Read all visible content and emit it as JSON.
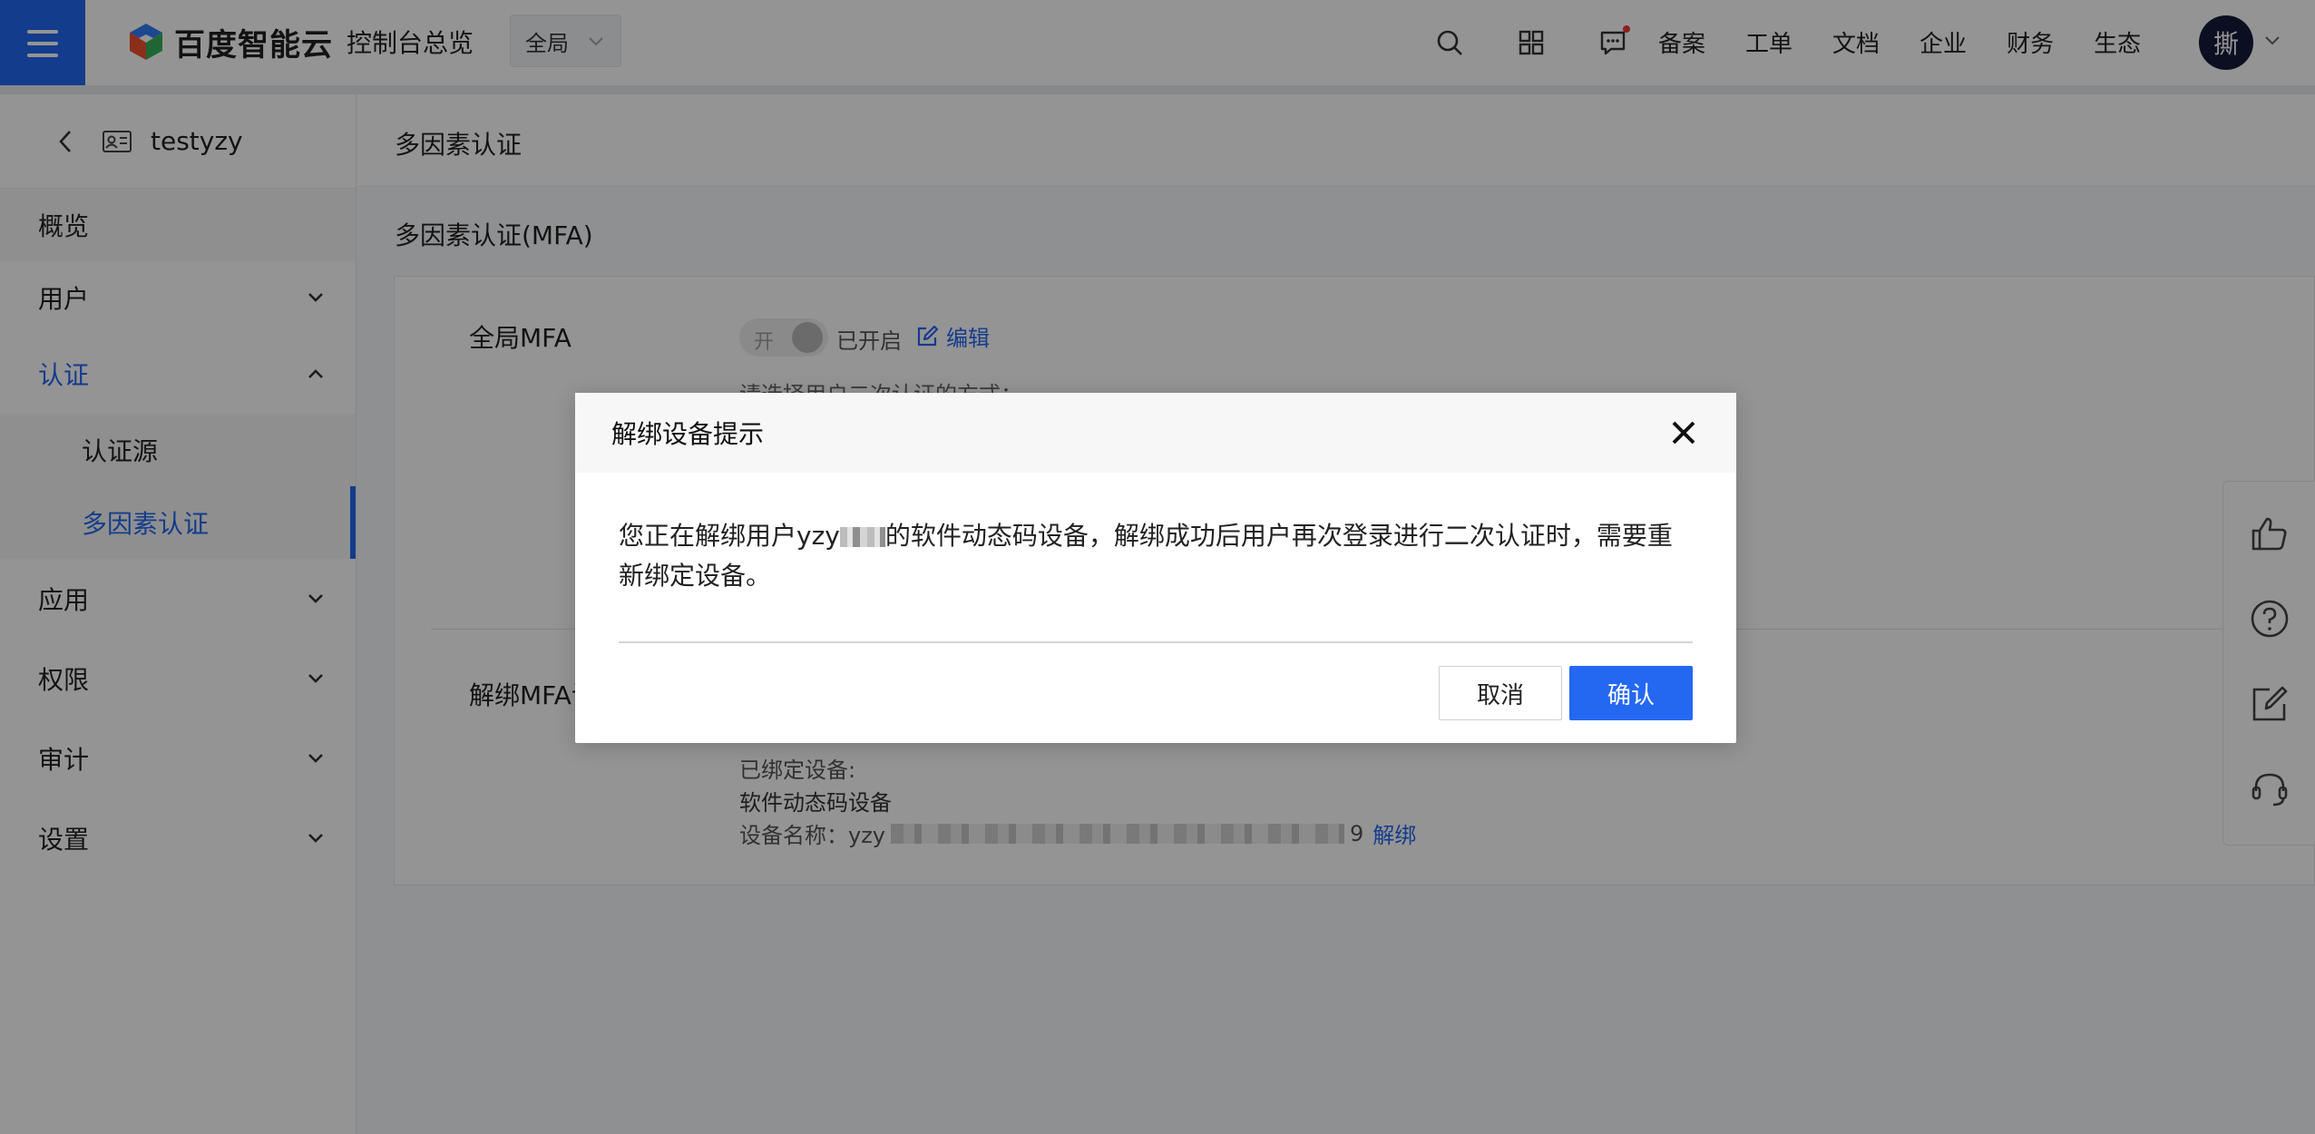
{
  "brand": {
    "name": "百度智能云",
    "accent": "#2468f2"
  },
  "header": {
    "console": "控制台总览",
    "region": "全局",
    "nav_links": [
      "备案",
      "工单",
      "文档",
      "企业",
      "财务",
      "生态"
    ],
    "avatar_text": "撕"
  },
  "sidebar": {
    "account": "testyzy",
    "items": {
      "overview": "概览",
      "users": "用户",
      "auth": "认证",
      "auth_source": "认证源",
      "mfa": "多因素认证",
      "apps": "应用",
      "permissions": "权限",
      "audit": "审计",
      "settings": "设置"
    }
  },
  "main": {
    "breadcrumb": "多因素认证",
    "section_title": "多因素认证(MFA)",
    "global_mfa_label": "全局MFA",
    "toggle_text": "开",
    "toggle_state": "已开启",
    "edit_label": "编辑",
    "hint_text": "请选择用户二次认证的方式：",
    "unbind_label": "解绑MFA设备",
    "bound_devices_label": "已绑定设备:",
    "device_type": "软件动态码设备",
    "device_name_prefix": "设备名称：yzy",
    "device_name_suffix": "9",
    "unbind_link": "解绑"
  },
  "modal": {
    "title": "解绑设备提示",
    "body_before": "您正在解绑用户yzy",
    "body_after": "的软件动态码设备，解绑成功后用户再次登录进行二次认证时，需要重新绑定设备。",
    "cancel": "取消",
    "confirm": "确认"
  }
}
